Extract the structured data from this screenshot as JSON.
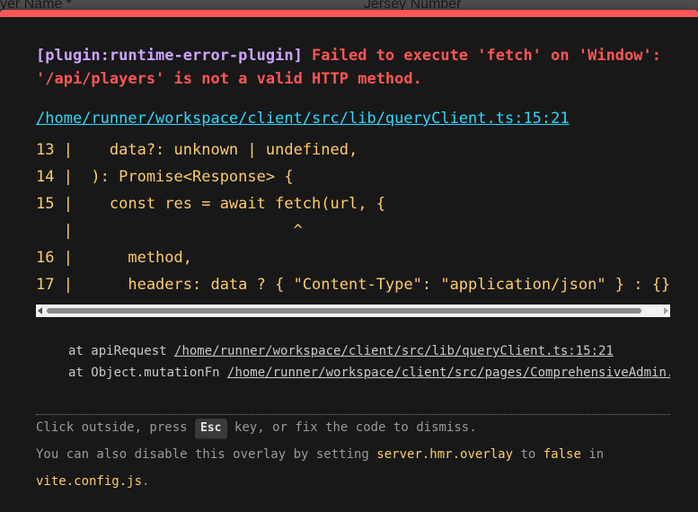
{
  "background": {
    "left_label": "yer Name *",
    "right_label": "Jersey Number"
  },
  "overlay": {
    "accent_color": "#ff5555",
    "plugin": "[plugin:runtime-error-plugin]",
    "message": " Failed to execute 'fetch' on 'Window': '/api/players' is not a valid HTTP method.",
    "file": "/home/runner/workspace/client/src/lib/queryClient.ts:15:21",
    "frame_lines": [
      "13 |    data?: unknown | undefined,",
      "14 |  ): Promise<Response> {",
      "15 |    const res = await fetch(url, {",
      "   |                        ^",
      "16 |      method,",
      "17 |      headers: data ? { \"Content-Type\": \"application/json\" } : {},"
    ],
    "stack": [
      {
        "prefix": "at apiRequest ",
        "link": "/home/runner/workspace/client/src/lib/queryClient.ts:15:21"
      },
      {
        "prefix": "at Object.mutationFn ",
        "link": "/home/runner/workspace/client/src/pages/ComprehensiveAdmin.tsx"
      }
    ],
    "tip": {
      "line1_before": "Click outside, press ",
      "key": "Esc",
      "line1_after": " key, or fix the code to dismiss.",
      "line2_before": "You can also disable this overlay by setting ",
      "setting": "server.hmr.overlay",
      "line2_mid": " to ",
      "value": "false",
      "line2_after": " in",
      "config_file": "vite.config.js",
      "line3_after": "."
    }
  }
}
